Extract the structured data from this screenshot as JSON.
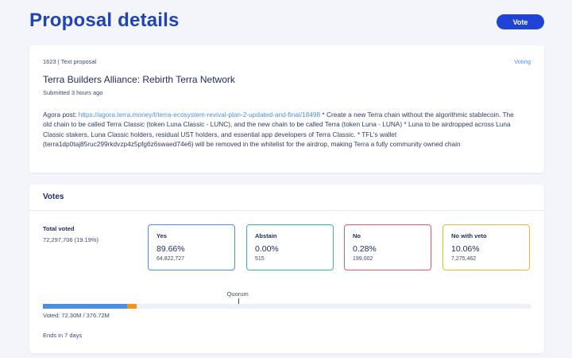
{
  "header": {
    "title": "Proposal details",
    "vote_button": "Vote"
  },
  "proposal": {
    "meta": "1623 | Text proposal",
    "status": "Voting",
    "title": "Terra Builders Alliance: Rebirth Terra Network",
    "submitted": "Submitted 3 hours ago",
    "desc_prefix": "Agora post: ",
    "desc_link": "https://agora.terra.money/t/terra-ecosystem-revival-plan-2-updated-and-final/18498",
    "desc_rest": " * Create a new Terra chain without the algorithmic stablecoin. The old chain to be called Terra Classic (token Luna Classic - LUNC), and the new chain to be called Terra (token Luna - LUNA) * Luna to be airdropped across Luna Classic stakers, Luna Classic holders, residual UST holders, and essential app developers of Terra Classic. * TFL's wallet (terra1dp0taj85ruc299rkdvzp4z5pfg6z6swaed74e6) will be removed in the whitelist for the airdrop, making Terra a fully community owned chain"
  },
  "votes": {
    "header": "Votes",
    "total_label": "Total voted",
    "total_value": "72,297,706 (19.19%)",
    "options": [
      {
        "name": "Yes",
        "pct": "89.66%",
        "count": "64,822,727",
        "color": "#4b8fe2"
      },
      {
        "name": "Abstain",
        "pct": "0.00%",
        "count": "515",
        "color": "#39b8a0"
      },
      {
        "name": "No",
        "pct": "0.28%",
        "count": "199,002",
        "color": "#e55b6a"
      },
      {
        "name": "No with veto",
        "pct": "10.06%",
        "count": "7,275,462",
        "color": "#eeb934"
      }
    ],
    "quorum_label": "Quorum",
    "quorum_fraction": 0.4,
    "voted_fraction": 0.1919,
    "bar_segments": [
      {
        "name": "Yes",
        "fraction": 0.8966,
        "color": "#4b8fe2"
      },
      {
        "name": "Abstain",
        "fraction": 0.0,
        "color": "#39b8a0"
      },
      {
        "name": "No",
        "fraction": 0.0028,
        "color": "#e55b6a"
      },
      {
        "name": "No with veto",
        "fraction": 0.1006,
        "color": "#f7931a"
      }
    ],
    "voted_text": "Voted: 72.30M / 376.72M",
    "ends": "Ends in 7 days"
  }
}
